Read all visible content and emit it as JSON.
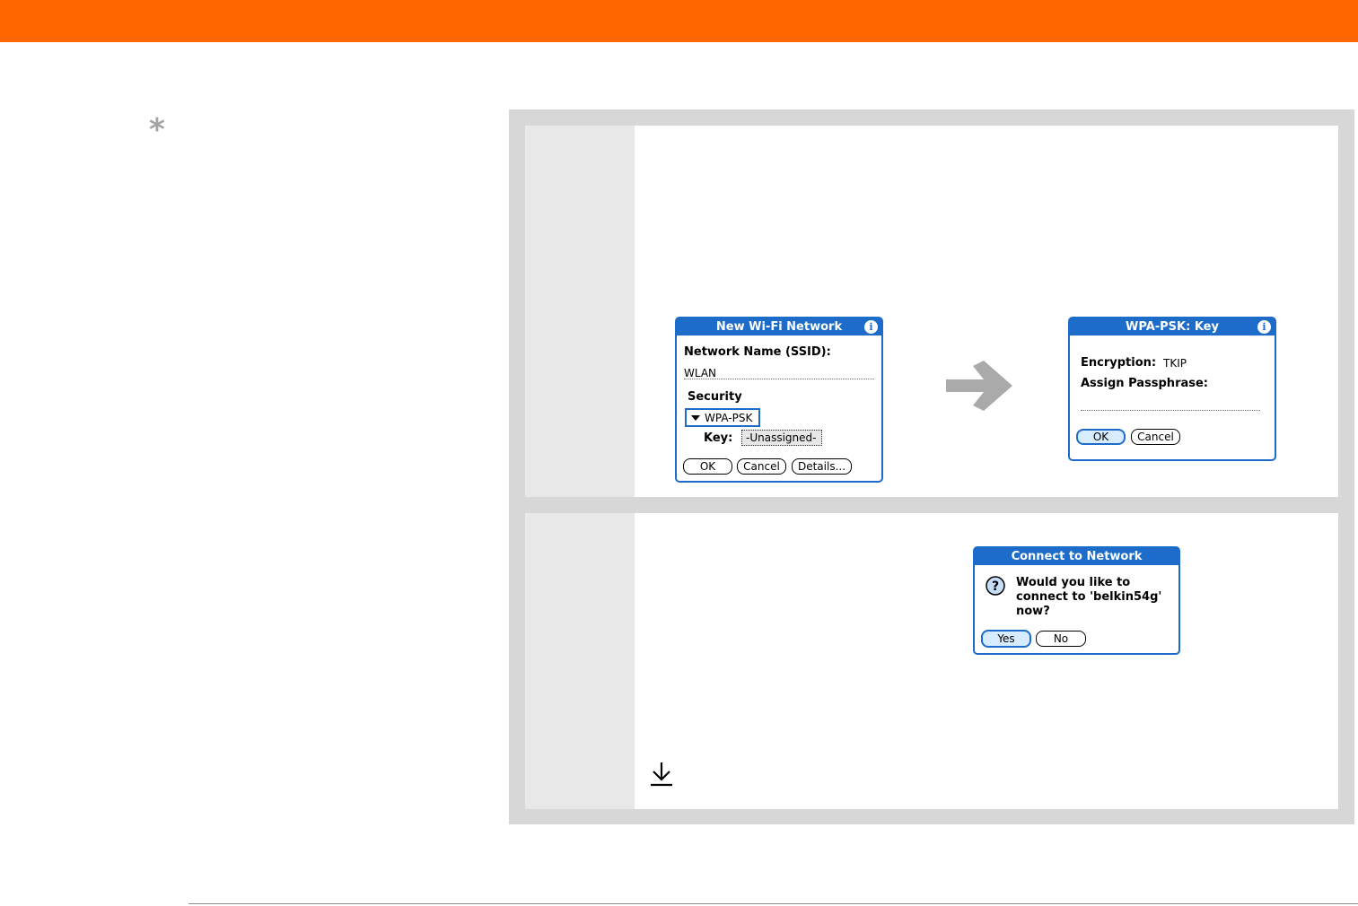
{
  "decor": {
    "tip_symbol": "*"
  },
  "dialog_wifi": {
    "title": "New Wi-Fi Network",
    "info": "i",
    "name_label": "Network Name (SSID):",
    "name_value": "WLAN",
    "security_label": "Security",
    "security_value": "WPA-PSK",
    "key_label": "Key:",
    "key_value": "-Unassigned-",
    "buttons": {
      "ok": "OK",
      "cancel": "Cancel",
      "details": "Details..."
    }
  },
  "dialog_wpa": {
    "title": "WPA-PSK: Key",
    "info": "i",
    "encryption_label": "Encryption:",
    "encryption_value": "TKIP",
    "passphrase_label": "Assign Passphrase:",
    "buttons": {
      "ok": "OK",
      "cancel": "Cancel"
    }
  },
  "dialog_connect": {
    "title": "Connect to Network",
    "help": "?",
    "message_lines": [
      "Would you like to",
      "connect to 'belkin54g'",
      "now?"
    ],
    "buttons": {
      "yes": "Yes",
      "no": "No"
    }
  },
  "colors": {
    "header_bar": "#ff6600",
    "panel_background": "#d7d7d7",
    "step_number_column": "#e8e8e8",
    "palm_blue": "#1d6cc9",
    "arrow_gray": "#aaaaaa"
  }
}
